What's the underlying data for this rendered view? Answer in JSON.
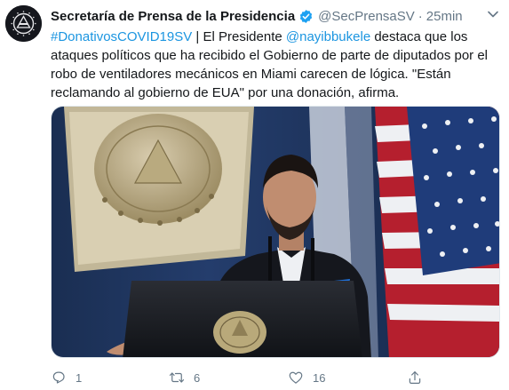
{
  "author": {
    "display_name": "Secretaría de Prensa de la Presidencia",
    "handle": "@SecPrensaSV",
    "separator": "·",
    "time": "25min",
    "verified": true
  },
  "tweet": {
    "hashtag": "#DonativosCOVID19SV",
    "text_1": " | El Presidente ",
    "mention": "@nayibbukele",
    "text_2": " destaca que los ataques políticos que ha recibido el Gobierno de parte de diputados por el robo de ventiladores mecánicos en Miami carecen de lógica. \"Están reclamando al gobierno de EUA\" por una donación, afirma."
  },
  "actions": {
    "reply_count": "1",
    "retweet_count": "6",
    "like_count": "16"
  },
  "icons": {
    "verified": "verified-badge-icon",
    "more": "chevron-down-icon",
    "reply": "reply-icon",
    "retweet": "retweet-icon",
    "like": "heart-icon",
    "share": "share-icon"
  },
  "colors": {
    "link": "#1b95e0",
    "muted": "#657786",
    "verified": "#1da1f2",
    "text": "#14171a"
  }
}
